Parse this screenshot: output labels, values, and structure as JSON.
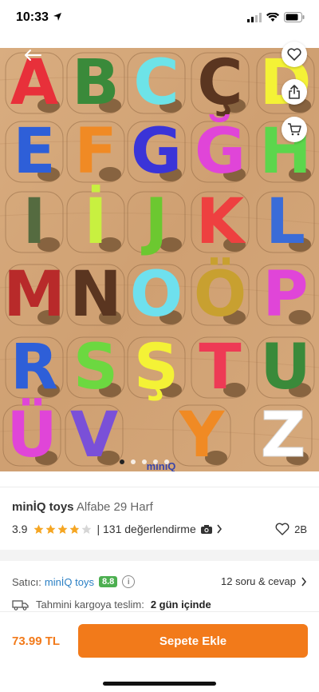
{
  "status_bar": {
    "time": "10:33"
  },
  "hero": {
    "letters": [
      "A",
      "B",
      "C",
      "Ç",
      "D",
      "E",
      "F",
      "G",
      "Ğ",
      "H",
      "I",
      "İ",
      "J",
      "K",
      "L",
      "M",
      "N",
      "O",
      "Ö",
      "P",
      "R",
      "S",
      "Ş",
      "T",
      "U",
      "Ü",
      "V",
      "Y",
      "Z"
    ],
    "letter_colors": [
      "#e8303a",
      "#3a8a3a",
      "#6de3e8",
      "#5a3520",
      "#f4f236",
      "#2e5fd8",
      "#f08a24",
      "#3a34d8",
      "#e045d8",
      "#5cd64c",
      "#556b40",
      "#c8f040",
      "#6cc830",
      "#ee4040",
      "#3a6cd8",
      "#b82a2a",
      "#5a3520",
      "#6ee0ee",
      "#c8a030",
      "#e045d8",
      "#2e5fd8",
      "#6cd840",
      "#f4f236",
      "#ee3a55",
      "#3a8a3a",
      "#e045d8",
      "#7a50d8",
      "#f08a24",
      "#ffffff"
    ],
    "logo_text": "miniQ",
    "active_dot": 0
  },
  "product": {
    "brand": "minİQ toys",
    "name": "Alfabe 29 Harf",
    "rating": "3.9",
    "rating_fraction": 0.78,
    "reviews": "| 131 değerlendirme",
    "camera_icon": "camera-icon",
    "favorites": "2B"
  },
  "seller": {
    "label": "Satıcı:",
    "name": "minİQ toys",
    "score": "8.8",
    "qa": "12 soru & cevap"
  },
  "shipping": {
    "label": "Tahmini kargoya teslim:",
    "value": "2 gün içinde"
  },
  "bottom": {
    "price": "73.99 TL",
    "cta": "Sepete Ekle"
  },
  "colors": {
    "accent": "#f27a1a",
    "seller_name": "#2a7fc4",
    "score_badge": "#4caf50",
    "star": "#f5a623"
  }
}
